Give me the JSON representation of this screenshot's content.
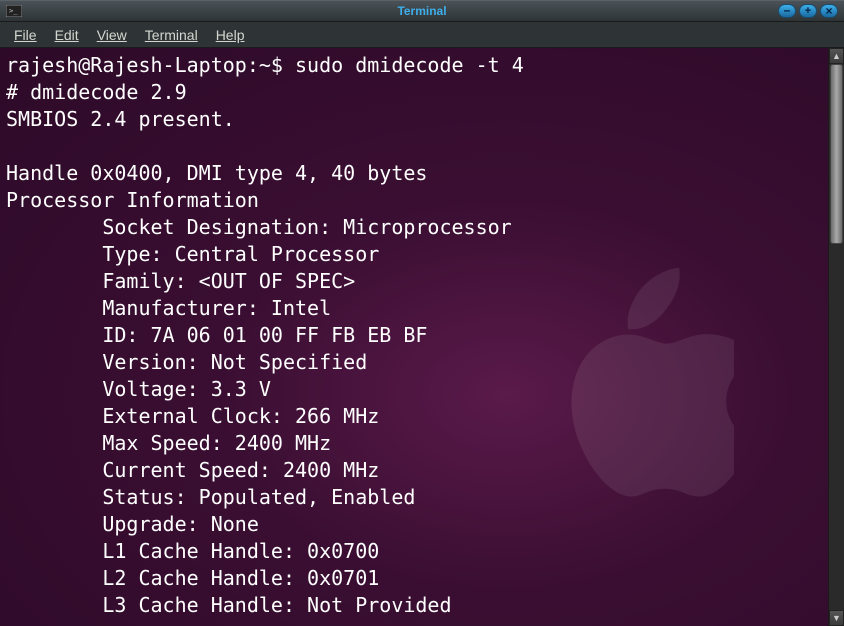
{
  "window": {
    "title": "Terminal"
  },
  "menubar": {
    "file": "File",
    "edit": "Edit",
    "view": "View",
    "terminal": "Terminal",
    "help": "Help"
  },
  "terminal": {
    "prompt": "rajesh@Rajesh-Laptop:~$ ",
    "command": "sudo dmidecode -t 4",
    "output": {
      "line1": "# dmidecode 2.9",
      "line2": "SMBIOS 2.4 present.",
      "blank1": "",
      "line3": "Handle 0x0400, DMI type 4, 40 bytes",
      "line4": "Processor Information",
      "fields": [
        "        Socket Designation: Microprocessor",
        "        Type: Central Processor",
        "        Family: <OUT OF SPEC>",
        "        Manufacturer: Intel",
        "        ID: 7A 06 01 00 FF FB EB BF",
        "        Version: Not Specified",
        "        Voltage: 3.3 V",
        "        External Clock: 266 MHz",
        "        Max Speed: 2400 MHz",
        "        Current Speed: 2400 MHz",
        "        Status: Populated, Enabled",
        "        Upgrade: None",
        "        L1 Cache Handle: 0x0700",
        "        L2 Cache Handle: 0x0701",
        "        L3 Cache Handle: Not Provided"
      ]
    }
  }
}
